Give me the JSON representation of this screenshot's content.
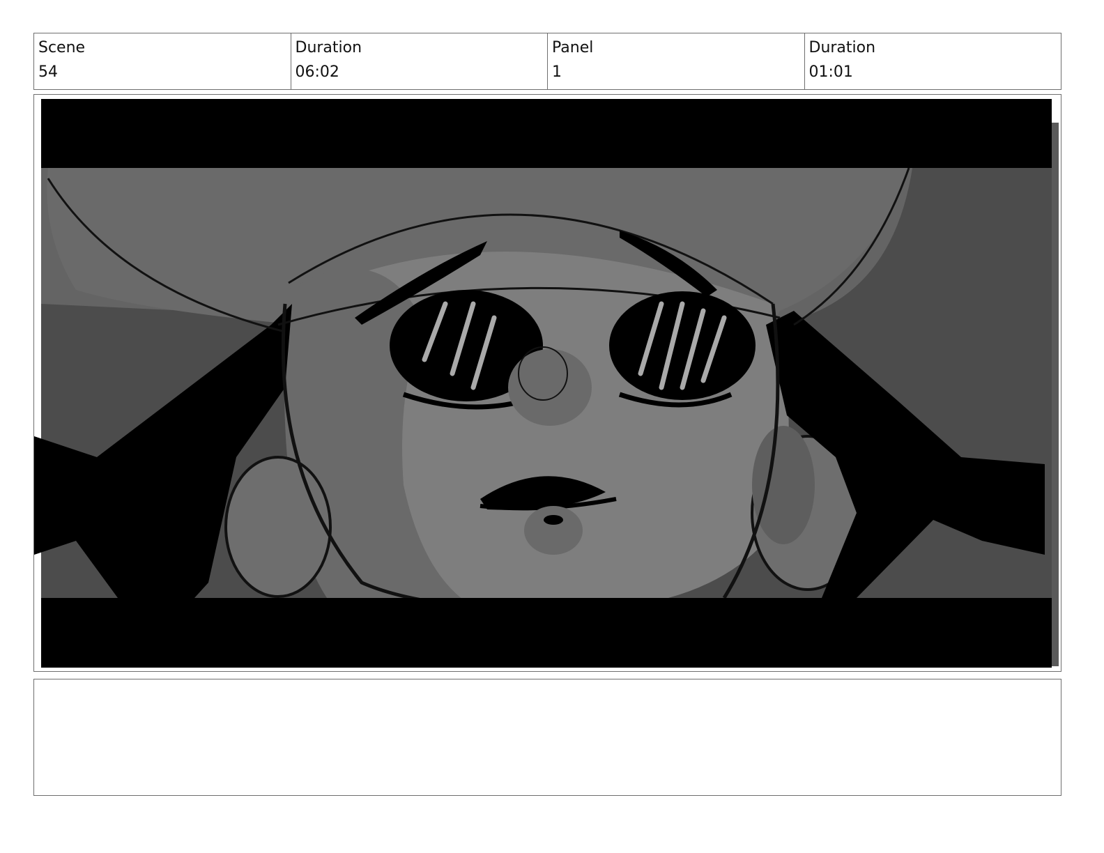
{
  "header": {
    "scene_label": "Scene",
    "scene_value": "54",
    "scene_duration_label": "Duration",
    "scene_duration_value": "06:02",
    "panel_label": "Panel",
    "panel_value": "1",
    "panel_duration_label": "Duration",
    "panel_duration_value": "01:01"
  },
  "notes": {
    "text": ""
  },
  "colors": {
    "letterbox": "#000000",
    "background_dark": "#4c4c4c",
    "background_mid": "#646464",
    "face": "#7d7d7d",
    "border": "#6e6e6e"
  }
}
